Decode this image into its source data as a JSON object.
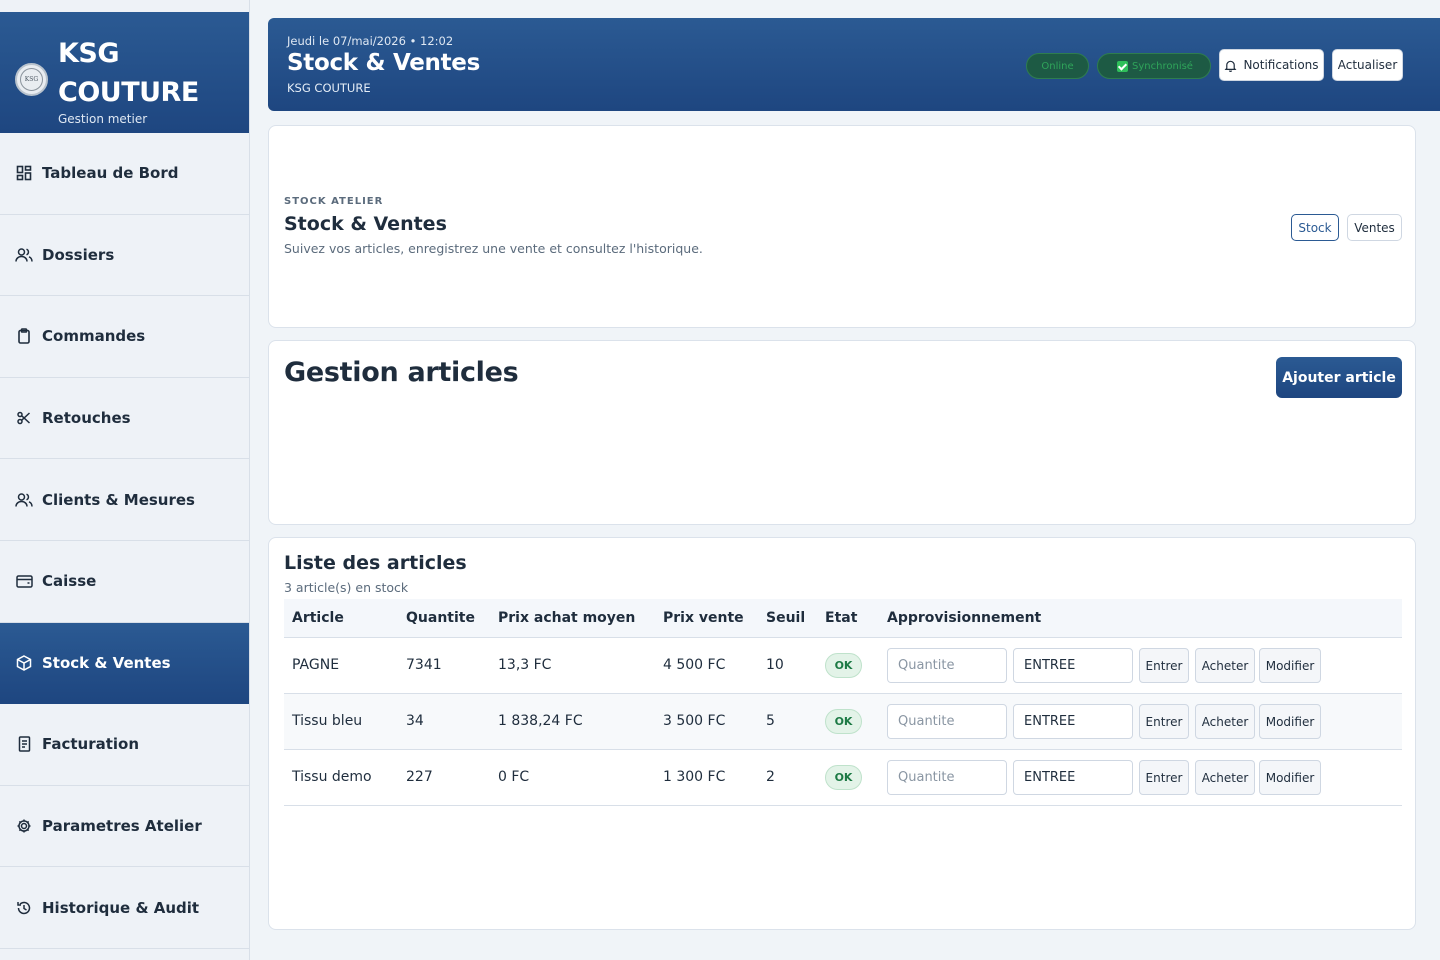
{
  "brand": {
    "name": "KSG COUTURE",
    "subtitle": "Gestion metier",
    "logo_text": "KSG"
  },
  "sidebar": {
    "items": [
      {
        "label": "Tableau de Bord",
        "icon": "dashboard-icon",
        "active": false
      },
      {
        "label": "Dossiers",
        "icon": "users-icon",
        "active": false
      },
      {
        "label": "Commandes",
        "icon": "clipboard-icon",
        "active": false
      },
      {
        "label": "Retouches",
        "icon": "scissors-icon",
        "active": false
      },
      {
        "label": "Clients & Mesures",
        "icon": "users-icon",
        "active": false
      },
      {
        "label": "Caisse",
        "icon": "wallet-icon",
        "active": false
      },
      {
        "label": "Stock & Ventes",
        "icon": "box-icon",
        "active": true
      },
      {
        "label": "Facturation",
        "icon": "receipt-icon",
        "active": false
      },
      {
        "label": "Parametres Atelier",
        "icon": "gear-icon",
        "active": false
      },
      {
        "label": "Historique & Audit",
        "icon": "history-icon",
        "active": false
      }
    ]
  },
  "header": {
    "date": "Jeudi le 07/mai/2026 • 12:02",
    "title": "Stock & Ventes",
    "subtitle": "KSG COUTURE",
    "status_online": "Online",
    "status_sync": "Synchronisé",
    "notifications_label": "Notifications",
    "refresh_label": "Actualiser"
  },
  "intro": {
    "eyebrow": "STOCK ATELIER",
    "title": "Stock & Ventes",
    "description": "Suivez vos articles, enregistrez une vente et consultez l'historique.",
    "tab_stock": "Stock",
    "tab_ventes": "Ventes"
  },
  "management": {
    "title": "Gestion articles",
    "add_button": "Ajouter article"
  },
  "list": {
    "title": "Liste des articles",
    "count": "3 article(s) en stock",
    "columns": [
      "Article",
      "Quantite",
      "Prix achat moyen",
      "Prix vente",
      "Seuil",
      "Etat",
      "Approvisionnement"
    ],
    "rows": [
      {
        "article": "PAGNE",
        "quantite": "7341",
        "prix_achat": "13,3 FC",
        "prix_vente": "4 500 FC",
        "seuil": "10",
        "etat": "OK",
        "qty_placeholder": "Quantite",
        "type": "ENTREE",
        "btn_entrer": "Entrer",
        "btn_acheter": "Acheter",
        "btn_modifier": "Modifier"
      },
      {
        "article": "Tissu bleu",
        "quantite": "34",
        "prix_achat": "1 838,24 FC",
        "prix_vente": "3 500 FC",
        "seuil": "5",
        "etat": "OK",
        "qty_placeholder": "Quantite",
        "type": "ENTREE",
        "btn_entrer": "Entrer",
        "btn_acheter": "Acheter",
        "btn_modifier": "Modifier"
      },
      {
        "article": "Tissu demo",
        "quantite": "227",
        "prix_achat": "0 FC",
        "prix_vente": "1 300 FC",
        "seuil": "2",
        "etat": "OK",
        "qty_placeholder": "Quantite",
        "type": "ENTREE",
        "btn_entrer": "Entrer",
        "btn_acheter": "Acheter",
        "btn_modifier": "Modifier"
      }
    ]
  },
  "colors": {
    "primary": "#2b5a93",
    "primary_dark": "#1e4680",
    "ok_bg": "#e3f3e8",
    "ok_text": "#1d7a45"
  }
}
